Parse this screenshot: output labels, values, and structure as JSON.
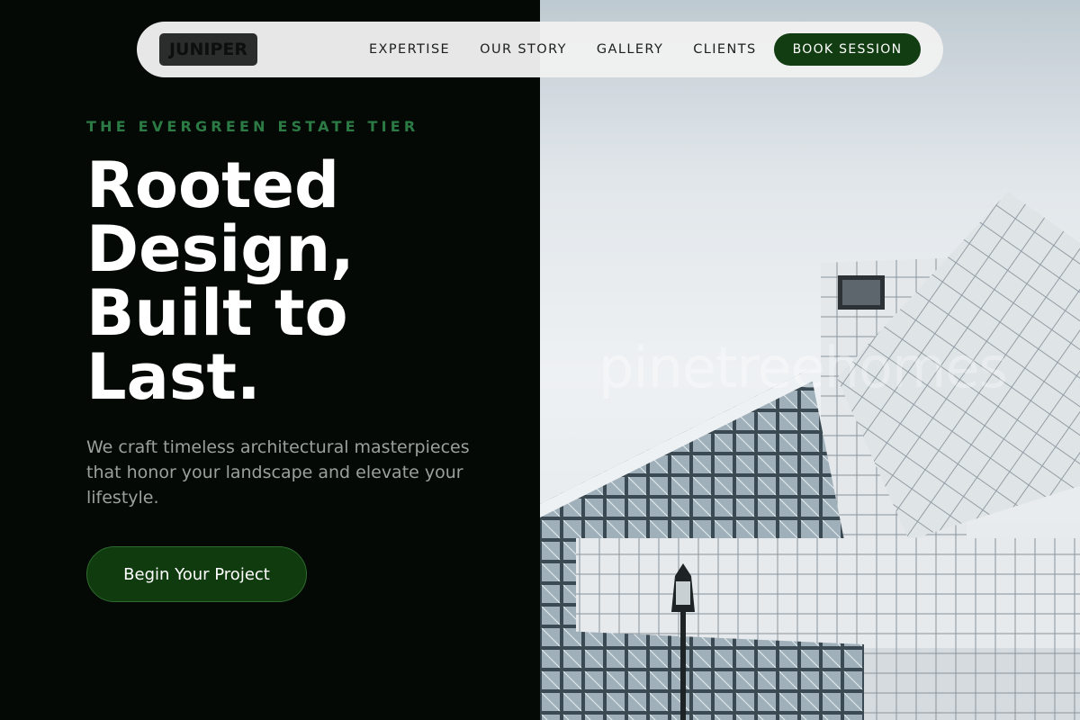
{
  "brand": {
    "logo_text": "JUNIPER"
  },
  "nav": {
    "links": [
      "EXPERTISE",
      "OUR STORY",
      "GALLERY",
      "CLIENTS"
    ],
    "cta_label": "BOOK SESSION"
  },
  "hero": {
    "eyebrow": "THE EVERGREEN ESTATE TIER",
    "headline_lines": [
      "Rooted",
      "Design,",
      "Built to",
      "Last."
    ],
    "lead": "We craft timeless architectural masterpieces that honor your landscape and elevate your lifestyle.",
    "cta_label": "Begin Your Project"
  },
  "image": {
    "watermark": "pinetreehomes"
  },
  "colors": {
    "dark_bg": "#040906",
    "accent_green": "#2c7a44",
    "button_green": "#123c12"
  }
}
